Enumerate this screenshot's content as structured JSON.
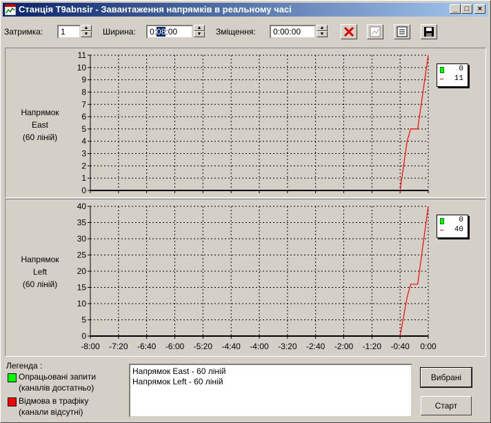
{
  "window": {
    "title": "Станція T9abnsir - Завантаження напрямків в реальному часі"
  },
  "toolbar": {
    "delay_label": "Затримка:",
    "delay_value": "1",
    "width_label": "Ширина:",
    "width_value_pre": "0:",
    "width_value_sel": "08",
    "width_value_post": ":00",
    "offset_label": "Зміщення:",
    "offset_value": "0:00:00",
    "icons": [
      "delete-icon",
      "chart-icon",
      "list-icon",
      "save-icon"
    ]
  },
  "charts": [
    {
      "dir_lines": [
        "Напрямок",
        "East",
        "(60 ліній)"
      ],
      "y_ticks": [
        "11",
        "10",
        "9",
        "8",
        "7",
        "6",
        "5",
        "4",
        "3",
        "2",
        "1",
        "0"
      ],
      "legend": {
        "green": "0",
        "red": "11"
      }
    },
    {
      "dir_lines": [
        "Напрямок",
        "Left",
        "(60 ліній)"
      ],
      "y_ticks": [
        "40",
        "35",
        "30",
        "25",
        "20",
        "15",
        "10",
        "5",
        "0"
      ],
      "legend": {
        "green": "0",
        "red": "40"
      }
    }
  ],
  "x_ticks": [
    "-8:00",
    "-7:20",
    "-6:40",
    "-6:00",
    "-5:20",
    "-4:40",
    "-4:00",
    "-3:20",
    "-2:40",
    "-2:00",
    "-1:20",
    "-0:40",
    "0:00"
  ],
  "chart_data": [
    {
      "type": "line",
      "xlim": [
        -480,
        0
      ],
      "ylim": [
        0,
        11
      ],
      "series": [
        {
          "color": "#ff0000",
          "x": [
            -40,
            -35,
            -30,
            -25,
            -20,
            -15,
            -10,
            -5,
            0
          ],
          "y": [
            0,
            2,
            4,
            5,
            5,
            5,
            7,
            9,
            11
          ]
        }
      ]
    },
    {
      "type": "line",
      "xlim": [
        -480,
        0
      ],
      "ylim": [
        0,
        40
      ],
      "series": [
        {
          "color": "#ff0000",
          "x": [
            -40,
            -35,
            -30,
            -25,
            -20,
            -15,
            -10,
            -5,
            0
          ],
          "y": [
            0,
            6,
            12,
            16,
            16,
            16,
            24,
            32,
            40
          ]
        }
      ]
    }
  ],
  "legend": {
    "title": "Легенда :",
    "green_line1": "Опрацьовані запити",
    "green_line2": "(каналів достатньо)",
    "red_line1": "Відмова в трафіку",
    "red_line2": "(канали відсутні)",
    "green_color": "#00ff00",
    "red_color": "#ff0000"
  },
  "directions_list": [
    "Напрямок East - 60 ліній",
    "Напрямок Left - 60 ліній"
  ],
  "buttons": {
    "selected": "Вибрані",
    "start": "Старт"
  }
}
